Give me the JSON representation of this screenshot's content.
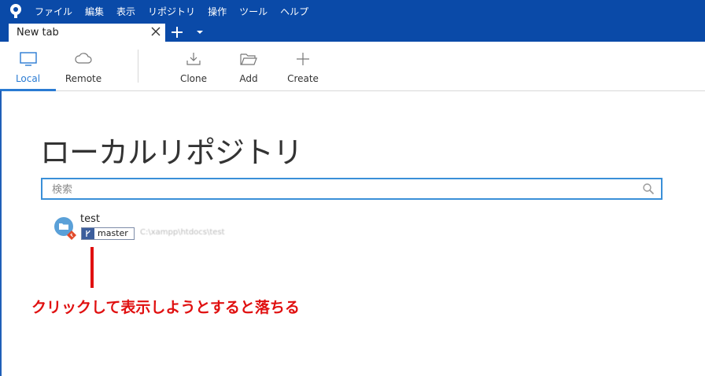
{
  "menu": {
    "items": [
      "ファイル",
      "編集",
      "表示",
      "リポジトリ",
      "操作",
      "ツール",
      "ヘルプ"
    ]
  },
  "tabs": {
    "active_label": "New tab"
  },
  "toolbar": {
    "local_label": "Local",
    "remote_label": "Remote",
    "clone_label": "Clone",
    "add_label": "Add",
    "create_label": "Create"
  },
  "main": {
    "title": "ローカルリポジトリ",
    "search_placeholder": "検索",
    "repos": [
      {
        "name": "test",
        "branch": "master",
        "path": "C:\\xampp\\htdocs\\test"
      }
    ]
  },
  "annotation": {
    "text": "クリックして表示しようとすると落ちる",
    "color": "#e01010"
  },
  "colors": {
    "brand_blue": "#0a4aa8",
    "accent": "#2a7bd3",
    "branch_badge": "#3c5e9c"
  }
}
